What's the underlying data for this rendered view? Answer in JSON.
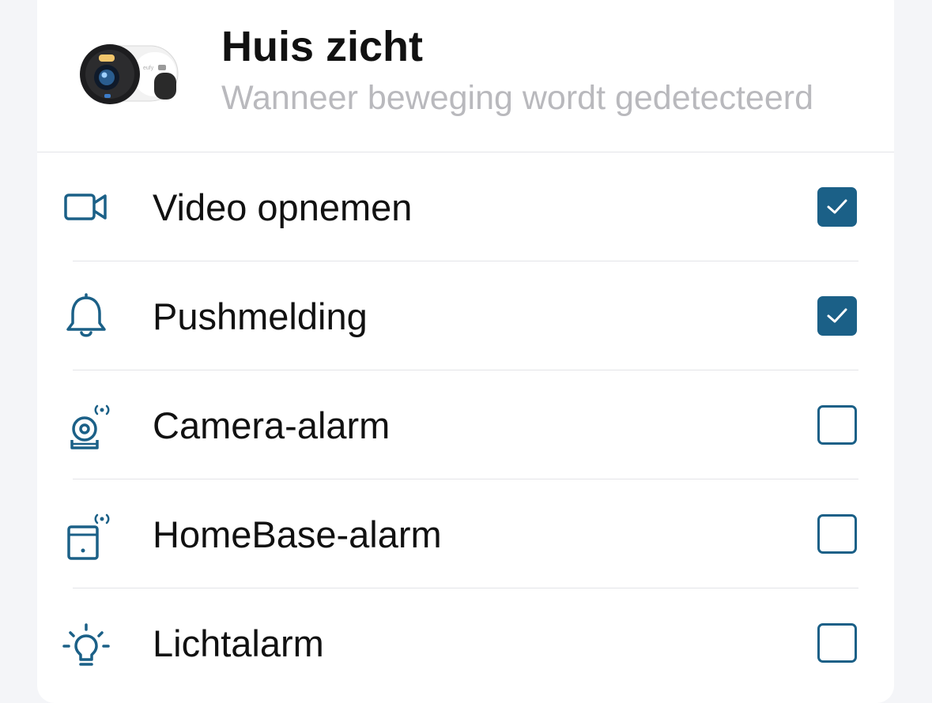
{
  "header": {
    "title": "Huis zicht",
    "subtitle": "Wanneer beweging wordt gedetecteerd",
    "device_image": "outdoor-camera-image"
  },
  "actions": [
    {
      "label": "Video opnemen",
      "icon": "video-camera-icon",
      "checked": true
    },
    {
      "label": "Pushmelding",
      "icon": "bell-icon",
      "checked": true
    },
    {
      "label": "Camera-alarm",
      "icon": "camera-alarm-icon",
      "checked": false
    },
    {
      "label": "HomeBase-alarm",
      "icon": "homebase-alarm-icon",
      "checked": false
    },
    {
      "label": "Lichtalarm",
      "icon": "light-bulb-icon",
      "checked": false
    }
  ],
  "colors": {
    "accent": "#1b6087",
    "text": "#111111",
    "subtitle": "#b9b9bd",
    "background": "#f4f5f8"
  }
}
